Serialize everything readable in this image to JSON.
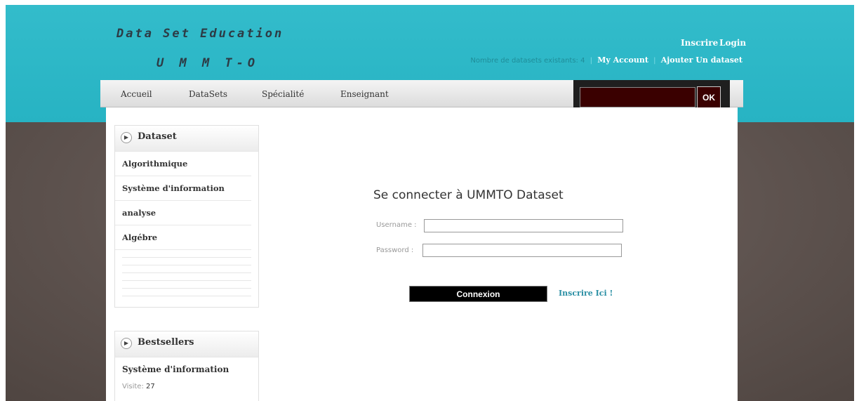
{
  "header": {
    "title_line1": "Data Set Education",
    "title_line2": "U M M T-O",
    "links": {
      "inscrire": "Inscrire",
      "login": "Login"
    },
    "dataset_count_text": "Nombre de datasets existants: 4",
    "my_account": "My Account",
    "add_dataset": "Ajouter Un dataset",
    "separator": "|"
  },
  "nav": {
    "items": [
      "Accueil",
      "DataSets",
      "Spécialité",
      "Enseignant"
    ]
  },
  "search": {
    "value": "",
    "button_label": "OK"
  },
  "sidebar": {
    "dataset_box": {
      "title": "Dataset",
      "items": [
        "Algorithmique",
        "Système d'information",
        "analyse",
        "Algébre"
      ]
    },
    "bestsellers_box": {
      "title": "Bestsellers",
      "item_title": "Système d'information",
      "visit_label": "Visite:",
      "visit_count": "27"
    }
  },
  "login": {
    "heading": "Se connecter à UMMTO Dataset",
    "username_label": "Username :",
    "password_label": "Password :",
    "username_value": "",
    "password_value": "",
    "submit_label": "Connexion",
    "register_link": "Inscrire Ici !"
  },
  "colors": {
    "header_band": "#2cb8c8",
    "background": "#6a5f5a",
    "search_bg": "#3a0000",
    "link_accent": "#2a8fa4"
  }
}
